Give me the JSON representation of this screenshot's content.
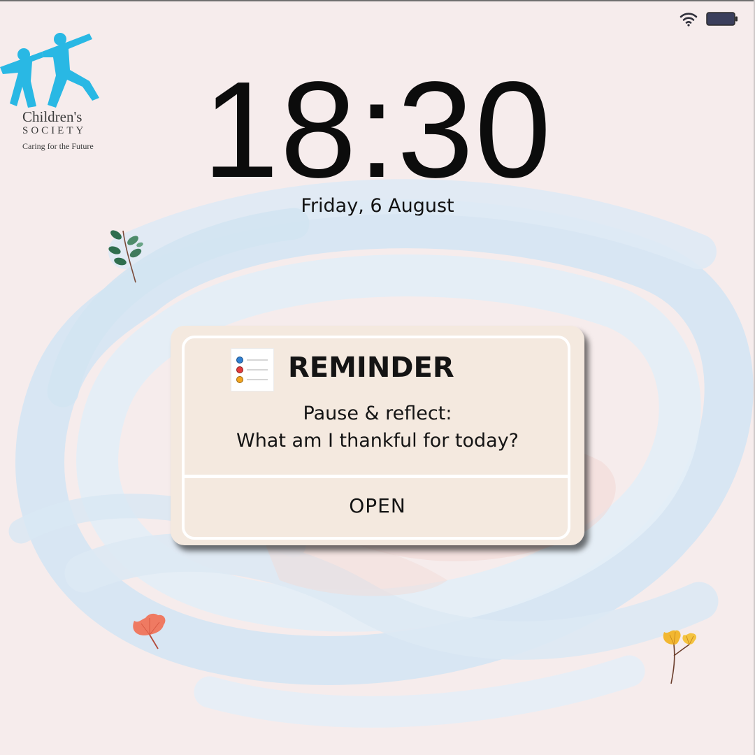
{
  "status_bar": {
    "wifi_icon": "wifi-icon",
    "battery_icon": "battery-icon"
  },
  "logo": {
    "name": "Children's",
    "name_line2": "SOCIETY",
    "tagline": "Caring for the Future",
    "color": "#29b8e4"
  },
  "lock_screen": {
    "time": "18:30",
    "date": "Friday, 6 August"
  },
  "notification": {
    "app_icon": "reminders-list-icon",
    "title": "REMINDER",
    "message_line1": "Pause & reflect:",
    "message_line2": "What am I thankful for today?",
    "action_label": "OPEN"
  },
  "colors": {
    "background": "#f6ecec",
    "card": "#f4e9df",
    "swirl": "#d9e8f4",
    "text": "#141414"
  }
}
